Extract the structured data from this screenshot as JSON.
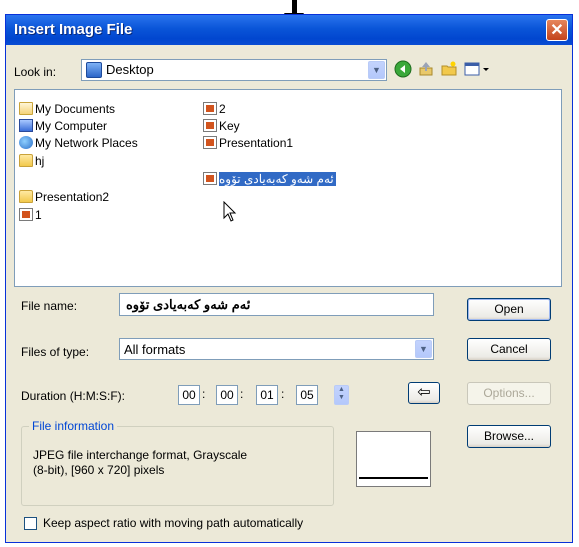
{
  "window": {
    "title": "Insert Image File",
    "close_glyph": "✕"
  },
  "look_in": {
    "label": "Look in:",
    "value": "Desktop"
  },
  "toolbar": {
    "back_icon": "back-arrow-icon",
    "up_icon": "up-folder-icon",
    "new_folder_icon": "new-folder-icon",
    "views_icon": "views-menu-icon"
  },
  "files": {
    "col1": [
      {
        "name": "My Documents",
        "icon": "my-documents-icon"
      },
      {
        "name": "My Computer",
        "icon": "my-computer-icon"
      },
      {
        "name": "My Network Places",
        "icon": "network-places-icon"
      },
      {
        "name": "hj",
        "icon": "folder-icon"
      },
      {
        "name": "Presentation2",
        "icon": "folder-icon"
      },
      {
        "name": "1",
        "icon": "presentation-file-icon"
      }
    ],
    "col2": [
      {
        "name": "2",
        "icon": "presentation-file-icon"
      },
      {
        "name": "Key",
        "icon": "presentation-file-icon"
      },
      {
        "name": "Presentation1",
        "icon": "presentation-file-icon"
      },
      {
        "name": "ئەم شەو كەبەيادى تۆوە",
        "icon": "presentation-file-icon",
        "selected": true
      }
    ]
  },
  "file_name": {
    "label": "File name:",
    "value": "ئەم شەو كەبەيادى تۆوە"
  },
  "files_of_type": {
    "label": "Files of type:",
    "value": "All formats"
  },
  "duration": {
    "label": "Duration (H:M:S:F):",
    "h": "00",
    "m": "00",
    "s": "01",
    "f": "05",
    "sep": ":"
  },
  "buttons": {
    "open": "Open",
    "cancel": "Cancel",
    "options": "Options...",
    "browse": "Browse...",
    "back_arrow": "⇦"
  },
  "file_info": {
    "legend": "File information",
    "line1": "JPEG file interchange format, Grayscale",
    "line2": "(8-bit), [960 x 720] pixels"
  },
  "keep_aspect": {
    "label": "Keep aspect ratio with moving path automatically",
    "checked": false
  },
  "colors": {
    "title_bar": "#0a55d8",
    "selection": "#316ac5",
    "dialog_bg": "#ece9d8",
    "group_legend": "#0046d5"
  }
}
